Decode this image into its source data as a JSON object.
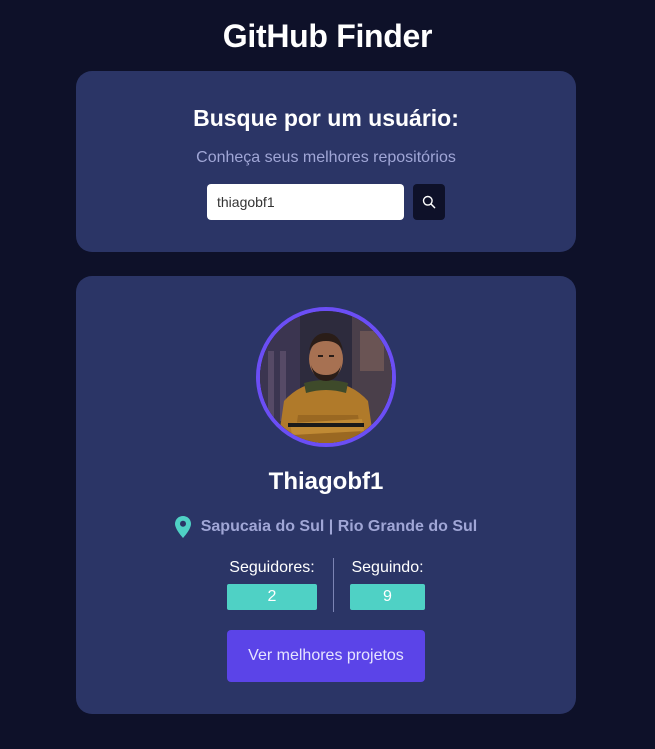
{
  "app": {
    "title": "GitHub Finder"
  },
  "search": {
    "heading": "Busque por um usuário:",
    "subtitle": "Conheça seus melhores repositórios",
    "input_value": "thiagobf1",
    "button_icon": "search-icon"
  },
  "profile": {
    "avatar_icon": "user-avatar-photo",
    "name": "Thiagobf1",
    "location_icon": "map-pin-icon",
    "location": "Sapucaia do Sul | Rio Grande do Sul",
    "followers_label": "Seguidores:",
    "followers_count": "2",
    "following_label": "Seguindo:",
    "following_count": "9",
    "projects_button_label": "Ver melhores projetos"
  },
  "colors": {
    "background": "#0e1129",
    "card": "#2b3566",
    "accent_teal": "#4fd1c5",
    "accent_purple": "#5b44e8",
    "avatar_border": "#6b4ef5",
    "muted_text": "#a0a6d6"
  }
}
